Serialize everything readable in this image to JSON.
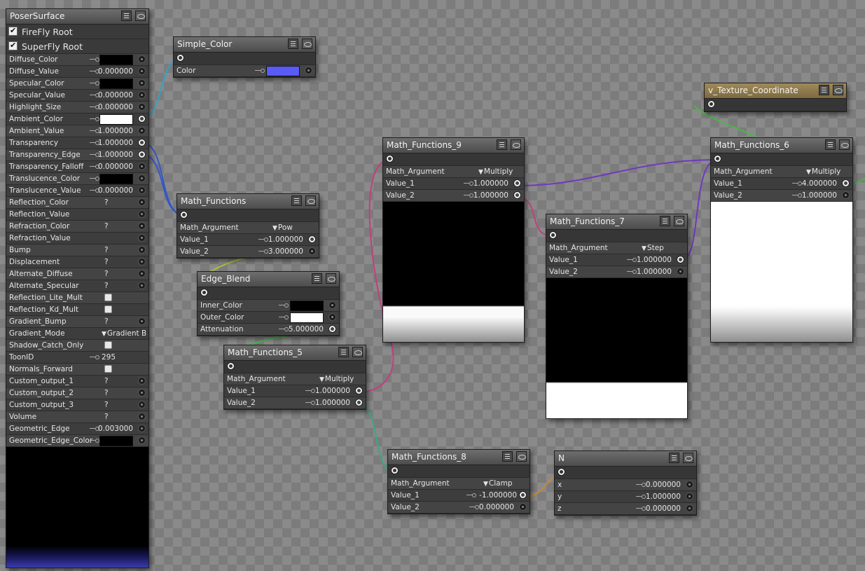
{
  "poser_surface": {
    "title": "PoserSurface",
    "roots": [
      {
        "label": "FireFly Root",
        "checked": true
      },
      {
        "label": "SuperFly Root",
        "checked": true
      }
    ],
    "rows": [
      {
        "label": "Diffuse_Color",
        "type": "color",
        "color": "#000000"
      },
      {
        "label": "Diffuse_Value",
        "type": "num",
        "value": "0.000000"
      },
      {
        "label": "Specular_Color",
        "type": "color",
        "color": "#000000"
      },
      {
        "label": "Specular_Value",
        "type": "num",
        "value": "0.000000"
      },
      {
        "label": "Highlight_Size",
        "type": "num",
        "value": "0.000000"
      },
      {
        "label": "Ambient_Color",
        "type": "color",
        "color": "#ffffff",
        "connected": true
      },
      {
        "label": "Ambient_Value",
        "type": "num",
        "value": "1.000000"
      },
      {
        "label": "Transparency",
        "type": "num",
        "value": "1.000000",
        "connected": true
      },
      {
        "label": "Transparency_Edge",
        "type": "num",
        "value": "1.000000",
        "connected": true
      },
      {
        "label": "Transparency_Falloff",
        "type": "num",
        "value": "0.000000"
      },
      {
        "label": "Translucence_Color",
        "type": "color",
        "color": "#000000"
      },
      {
        "label": "Translucence_Value",
        "type": "num",
        "value": "0.000000"
      },
      {
        "label": "Reflection_Color",
        "type": "q",
        "value": "?"
      },
      {
        "label": "Reflection_Value",
        "type": "blank"
      },
      {
        "label": "Refraction_Color",
        "type": "q",
        "value": "?"
      },
      {
        "label": "Refraction_Value",
        "type": "blank"
      },
      {
        "label": "Bump",
        "type": "q",
        "value": "?"
      },
      {
        "label": "Displacement",
        "type": "q",
        "value": "?"
      },
      {
        "label": "Alternate_Diffuse",
        "type": "q",
        "value": "?"
      },
      {
        "label": "Alternate_Specular",
        "type": "q",
        "value": "?"
      },
      {
        "label": "Reflection_Lite_Mult",
        "type": "check"
      },
      {
        "label": "Reflection_Kd_Mult",
        "type": "check"
      },
      {
        "label": "Gradient_Bump",
        "type": "q",
        "value": "?"
      },
      {
        "label": "Gradient_Mode",
        "type": "menu",
        "value": "Gradient B"
      },
      {
        "label": "Shadow_Catch_Only",
        "type": "check"
      },
      {
        "label": "ToonID",
        "type": "int",
        "value": "295"
      },
      {
        "label": "Normals_Forward",
        "type": "check"
      },
      {
        "label": "Custom_output_1",
        "type": "q",
        "value": "?"
      },
      {
        "label": "Custom_output_2",
        "type": "q",
        "value": "?"
      },
      {
        "label": "Custom_output_3",
        "type": "q",
        "value": "?"
      },
      {
        "label": "Volume",
        "type": "q",
        "value": "?"
      },
      {
        "label": "Geometric_Edge",
        "type": "num",
        "value": "0.003000"
      },
      {
        "label": "Geometric_Edge_Color",
        "type": "color",
        "color": "#000000"
      }
    ]
  },
  "nodes": {
    "simple_color": {
      "title": "Simple_Color",
      "rows": [
        {
          "label": "Color",
          "type": "color",
          "color": "#5a5af5"
        }
      ]
    },
    "math_functions": {
      "title": "Math_Functions",
      "argument": {
        "label": "Math_Argument",
        "value": "Pow"
      },
      "rows": [
        {
          "label": "Value_1",
          "value": "1.000000",
          "connected": true
        },
        {
          "label": "Value_2",
          "value": "3.000000"
        }
      ]
    },
    "edge_blend": {
      "title": "Edge_Blend",
      "rows": [
        {
          "label": "Inner_Color",
          "type": "color",
          "color": "#000000"
        },
        {
          "label": "Outer_Color",
          "type": "color",
          "color": "#ffffff"
        },
        {
          "label": "Attenuation",
          "type": "num",
          "value": "5.000000",
          "connected": true
        }
      ]
    },
    "math_functions_5": {
      "title": "Math_Functions_5",
      "argument": {
        "label": "Math_Argument",
        "value": "Multiply"
      },
      "rows": [
        {
          "label": "Value_1",
          "value": "1.000000",
          "connected": true
        },
        {
          "label": "Value_2",
          "value": "1.000000",
          "connected": true
        }
      ]
    },
    "math_functions_9": {
      "title": "Math_Functions_9",
      "argument": {
        "label": "Math_Argument",
        "value": "Multiply"
      },
      "rows": [
        {
          "label": "Value_1",
          "value": "1.000000",
          "connected": true
        },
        {
          "label": "Value_2",
          "value": "1.000000",
          "connected": true
        }
      ]
    },
    "math_functions_7": {
      "title": "Math_Functions_7",
      "argument": {
        "label": "Math_Argument",
        "value": "Step"
      },
      "rows": [
        {
          "label": "Value_1",
          "value": "1.000000",
          "connected": true
        },
        {
          "label": "Value_2",
          "value": "1.000000"
        }
      ]
    },
    "math_functions_6": {
      "title": "Math_Functions_6",
      "argument": {
        "label": "Math_Argument",
        "value": "Multiply"
      },
      "rows": [
        {
          "label": "Value_1",
          "value": "4.000000",
          "connected": true
        },
        {
          "label": "Value_2",
          "value": "1.000000"
        }
      ]
    },
    "v_texture_coordinate": {
      "title": "v_Texture_Coordinate"
    },
    "math_functions_8": {
      "title": "Math_Functions_8",
      "argument": {
        "label": "Math_Argument",
        "value": "Clamp"
      },
      "rows": [
        {
          "label": "Value_1",
          "value": "-1.000000",
          "connected": true
        },
        {
          "label": "Value_2",
          "value": "0.000000"
        }
      ]
    },
    "n": {
      "title": "N",
      "rows": [
        {
          "label": "x",
          "value": "0.000000"
        },
        {
          "label": "y",
          "value": "1.000000"
        },
        {
          "label": "z",
          "value": "0.000000"
        }
      ]
    }
  },
  "colors": {
    "wire_cyan": "#3a9fc0",
    "wire_blue": "#3456c8",
    "wire_yellow": "#a8c13a",
    "wire_green": "#4ab54a",
    "wire_magenta": "#c0407e",
    "wire_purple": "#7038c0",
    "wire_teal": "#3aa885",
    "wire_orange": "#c8873a"
  }
}
